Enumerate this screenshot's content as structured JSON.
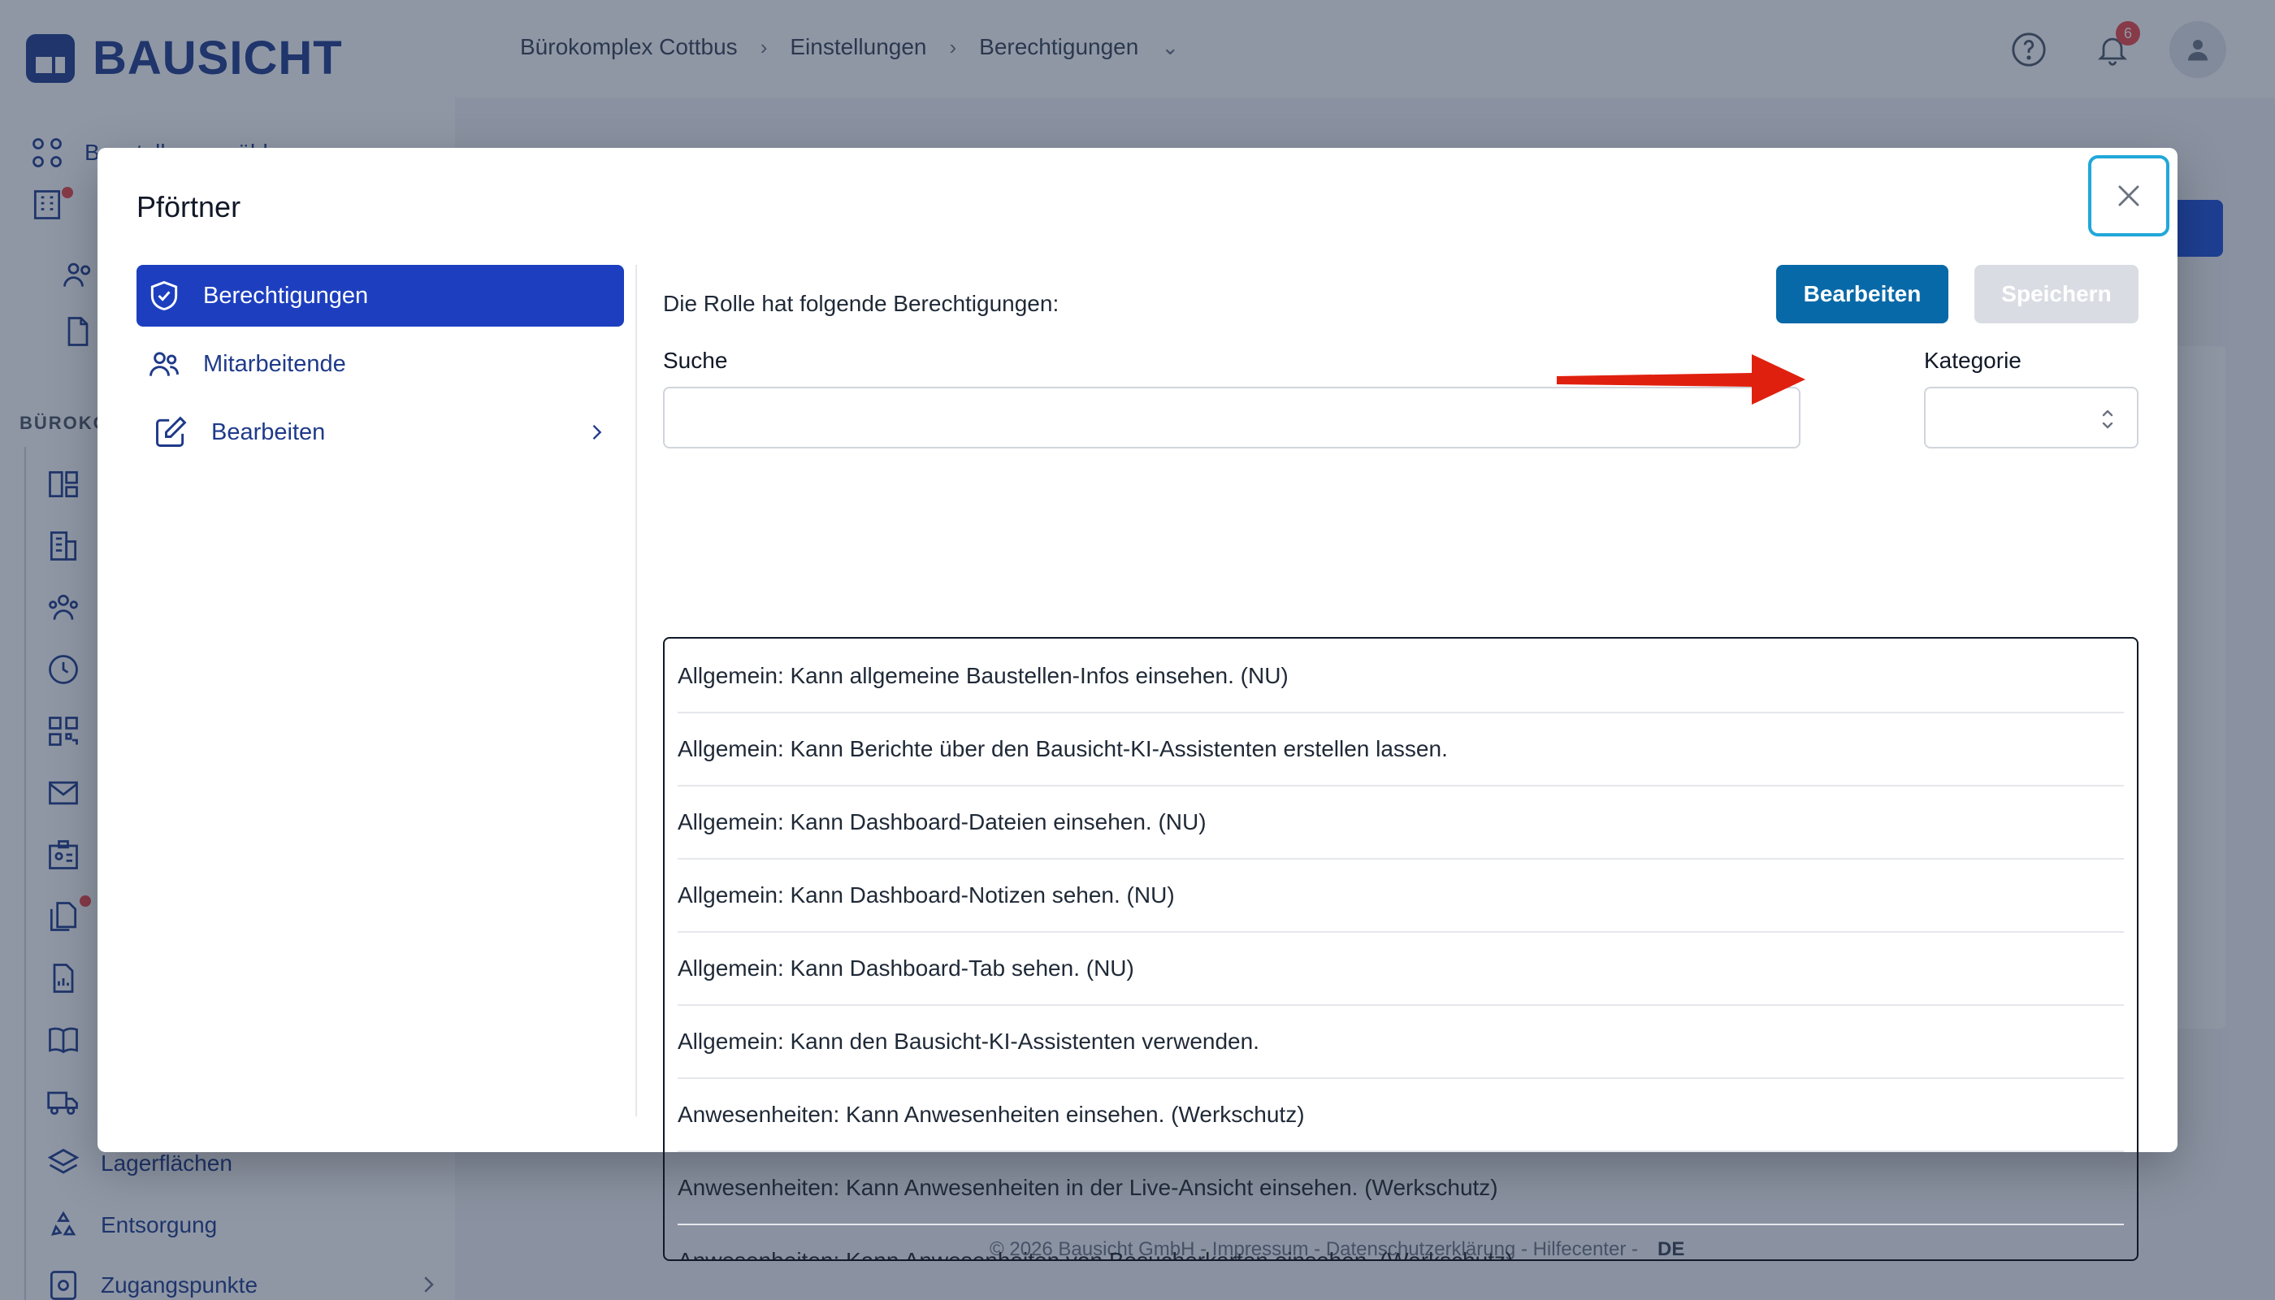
{
  "app": {
    "logo_text": "BAUSICHT",
    "breadcrumb": [
      "Bürokomplex Cottbus",
      "Einstellungen",
      "Berechtigungen"
    ],
    "notifications_count": "6"
  },
  "sidebar": {
    "select_site": "Baustelle auswählen",
    "section_label": "BÜROKO",
    "items_bottom": [
      "Lagerflächen",
      "Entsorgung",
      "Zugangspunkte"
    ]
  },
  "footer": {
    "text": "© 2026 Bausicht GmbH - Impressum - Datenschutzerklärung - Hilfecenter -",
    "lang": "DE"
  },
  "modal": {
    "title": "Pförtner",
    "nav": [
      {
        "label": "Berechtigungen",
        "icon": "shield-check-icon",
        "active": true
      },
      {
        "label": "Mitarbeitende",
        "icon": "users-icon",
        "active": false
      },
      {
        "label": "Bearbeiten",
        "icon": "pencil-square-icon",
        "active": false
      }
    ],
    "intro": "Die Rolle hat folgende Berechtigungen:",
    "edit_button": "Bearbeiten",
    "save_button": "Speichern",
    "search_label": "Suche",
    "search_value": "",
    "category_label": "Kategorie",
    "category_value": "",
    "permissions": [
      "Allgemein: Kann allgemeine Baustellen-Infos einsehen. (NU)",
      "Allgemein: Kann Berichte über den Bausicht-KI-Assistenten erstellen lassen.",
      "Allgemein: Kann Dashboard-Dateien einsehen. (NU)",
      "Allgemein: Kann Dashboard-Notizen sehen. (NU)",
      "Allgemein: Kann Dashboard-Tab sehen. (NU)",
      "Allgemein: Kann den Bausicht-KI-Assistenten verwenden.",
      "Anwesenheiten: Kann Anwesenheiten einsehen. (Werkschutz)",
      "Anwesenheiten: Kann Anwesenheiten in der Live-Ansicht einsehen. (Werkschutz)",
      "Anwesenheiten: Kann Anwesenheiten von Besucherkarten einsehen. (Werkschutz)"
    ]
  },
  "colors": {
    "primary": "#1d3fbf",
    "edit_button": "#0869a8",
    "arrow": "#e0200e",
    "focus_ring": "#22a7d9"
  }
}
